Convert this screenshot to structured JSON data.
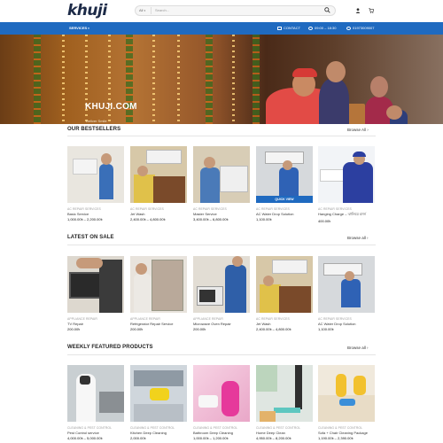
{
  "header": {
    "logo": "khuji",
    "search_category": "All",
    "search_placeholder": "Search..."
  },
  "nav": {
    "services": "SERVICES",
    "contact": "CONTACT",
    "hours": "09:00 – 18:30",
    "phone": "01973009007"
  },
  "hero": {
    "title": "KHUJI.COM",
    "subtitle": "Deliver Smile"
  },
  "sections": [
    {
      "title": "OUR BESTSELLERS",
      "browse": "Browse All",
      "products": [
        {
          "category": "AC REPAIR SERVICES",
          "name": "Basic Service",
          "price": "1,000.00৳ – 2,200.00৳"
        },
        {
          "category": "AC REPAIR SERVICES",
          "name": "Jet Wash",
          "price": "2,400.00৳ – 4,800.00৳"
        },
        {
          "category": "AC REPAIR SERVICES",
          "name": "Master Service",
          "price": "3,400.00৳ – 6,800.00৳"
        },
        {
          "category": "AC REPAIR SERVICES",
          "name": "AC Water Drop Solution",
          "price": "1,100.00৳",
          "quickview": "QUICK VIEW"
        },
        {
          "category": "AC REPAIR SERVICES",
          "name": "Hanging Charge – ঝালিয়ে চার্জ",
          "price": "400.00৳"
        }
      ]
    },
    {
      "title": "LATEST ON SALE",
      "browse": "Browse all",
      "products": [
        {
          "category": "APPLIANCE REPAIR",
          "name": "TV Repair",
          "price": "200.00৳"
        },
        {
          "category": "APPLIANCE REPAIR",
          "name": "Refrigerator Repair Service",
          "price": "200.00৳"
        },
        {
          "category": "APPLIANCE REPAIR",
          "name": "Microwave Oven Repair",
          "price": "200.00৳"
        },
        {
          "category": "AC REPAIR SERVICES",
          "name": "Jet Wash",
          "price": "2,400.00৳ – 4,800.00৳"
        },
        {
          "category": "AC REPAIR SERVICES",
          "name": "AC Water Drop Solution",
          "price": "1,100.00৳"
        }
      ]
    },
    {
      "title": "WEEKLY FEATURED PRODUCTS",
      "browse": "Browse all",
      "products": [
        {
          "category": "CLEANING & PEST CONTROL",
          "name": "Pest Control service",
          "price": "4,000.00৳ – 5,000.00৳"
        },
        {
          "category": "CLEANING & PEST CONTROL",
          "name": "Kitchen Deep Cleaning",
          "price": "2,000.00৳"
        },
        {
          "category": "CLEANING & PEST CONTROL",
          "name": "Bathroom Deep Cleaning",
          "price": "1,000.00৳ – 1,200.00৳"
        },
        {
          "category": "CLEANING & PEST CONTROL",
          "name": "Home Deep Clean",
          "price": "4,950.00৳ – 8,200.00৳"
        },
        {
          "category": "CLEANING & PEST CONTROL",
          "name": "Sofa + Chair Cleaning Package",
          "price": "1,190.00৳ – 2,390.00৳"
        }
      ]
    }
  ],
  "icons": {
    "search": "search-icon",
    "user": "user-icon",
    "cart": "cart-icon",
    "contact": "mail-icon",
    "hours": "clock-icon",
    "phone": "phone-icon",
    "browse_arrow": "chevron-right-icon"
  },
  "colors": {
    "primary": "#1f6ac0",
    "logo": "#1c2a47"
  }
}
